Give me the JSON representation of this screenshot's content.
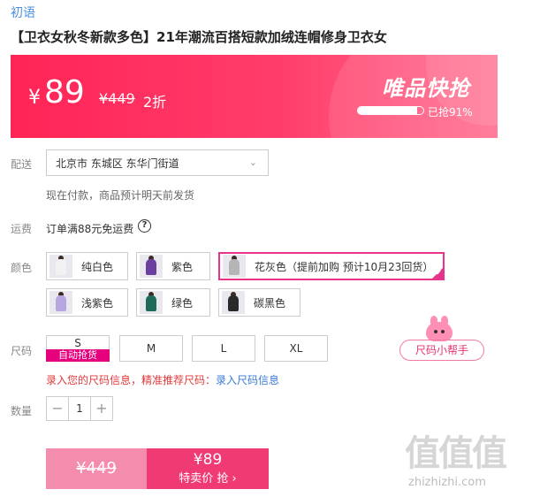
{
  "brand": "初语",
  "product_title": "【卫衣女秋冬新款多色】21年潮流百搭短款加绒连帽修身卫衣女",
  "banner": {
    "currency": "¥",
    "price": "89",
    "original_price": "¥449",
    "discount": "2折",
    "flash_sale_title": "唯品快抢",
    "sold_text": "已抢91%",
    "sold_percent": 91,
    "colors": {
      "start": "#ff2456",
      "end": "#ff6f8f"
    }
  },
  "shipping": {
    "label": "配送",
    "address": "北京市 东城区 东华门街道",
    "note": "现在付款，商品预计明天前发货"
  },
  "freight": {
    "label": "运费",
    "text": "订单满88元免运费",
    "help_glyph": "?"
  },
  "color_section": {
    "label": "颜色",
    "options": [
      {
        "name": "纯白色",
        "swatch": "#f2f2f2",
        "selected": false
      },
      {
        "name": "紫色",
        "swatch": "#6a3fa0",
        "selected": false
      },
      {
        "name": "花灰色（提前加购 预计10月23回货）",
        "swatch": "#b5b5b5",
        "selected": true
      },
      {
        "name": "浅紫色",
        "swatch": "#b8a6e0",
        "selected": false
      },
      {
        "name": "绿色",
        "swatch": "#1f6b5a",
        "selected": false
      },
      {
        "name": "碳黑色",
        "swatch": "#2a2a2a",
        "selected": false
      }
    ],
    "accent": "#e8338c"
  },
  "size_section": {
    "label": "尺码",
    "options": [
      "S",
      "M",
      "L",
      "XL"
    ],
    "s_badge": "自动抢货",
    "helper": "尺码小帮手",
    "info_text": "录入您的尺码信息，精准推荐尺码：",
    "info_link": "录入尺码信息"
  },
  "quantity": {
    "label": "数量",
    "minus": "−",
    "value": "1",
    "plus": "+"
  },
  "buy": {
    "original": "¥449",
    "price": "¥89",
    "action": "特卖价 抢 ›"
  },
  "watermark": {
    "zh": "值值值",
    "en": "zhizhizhi.com"
  }
}
